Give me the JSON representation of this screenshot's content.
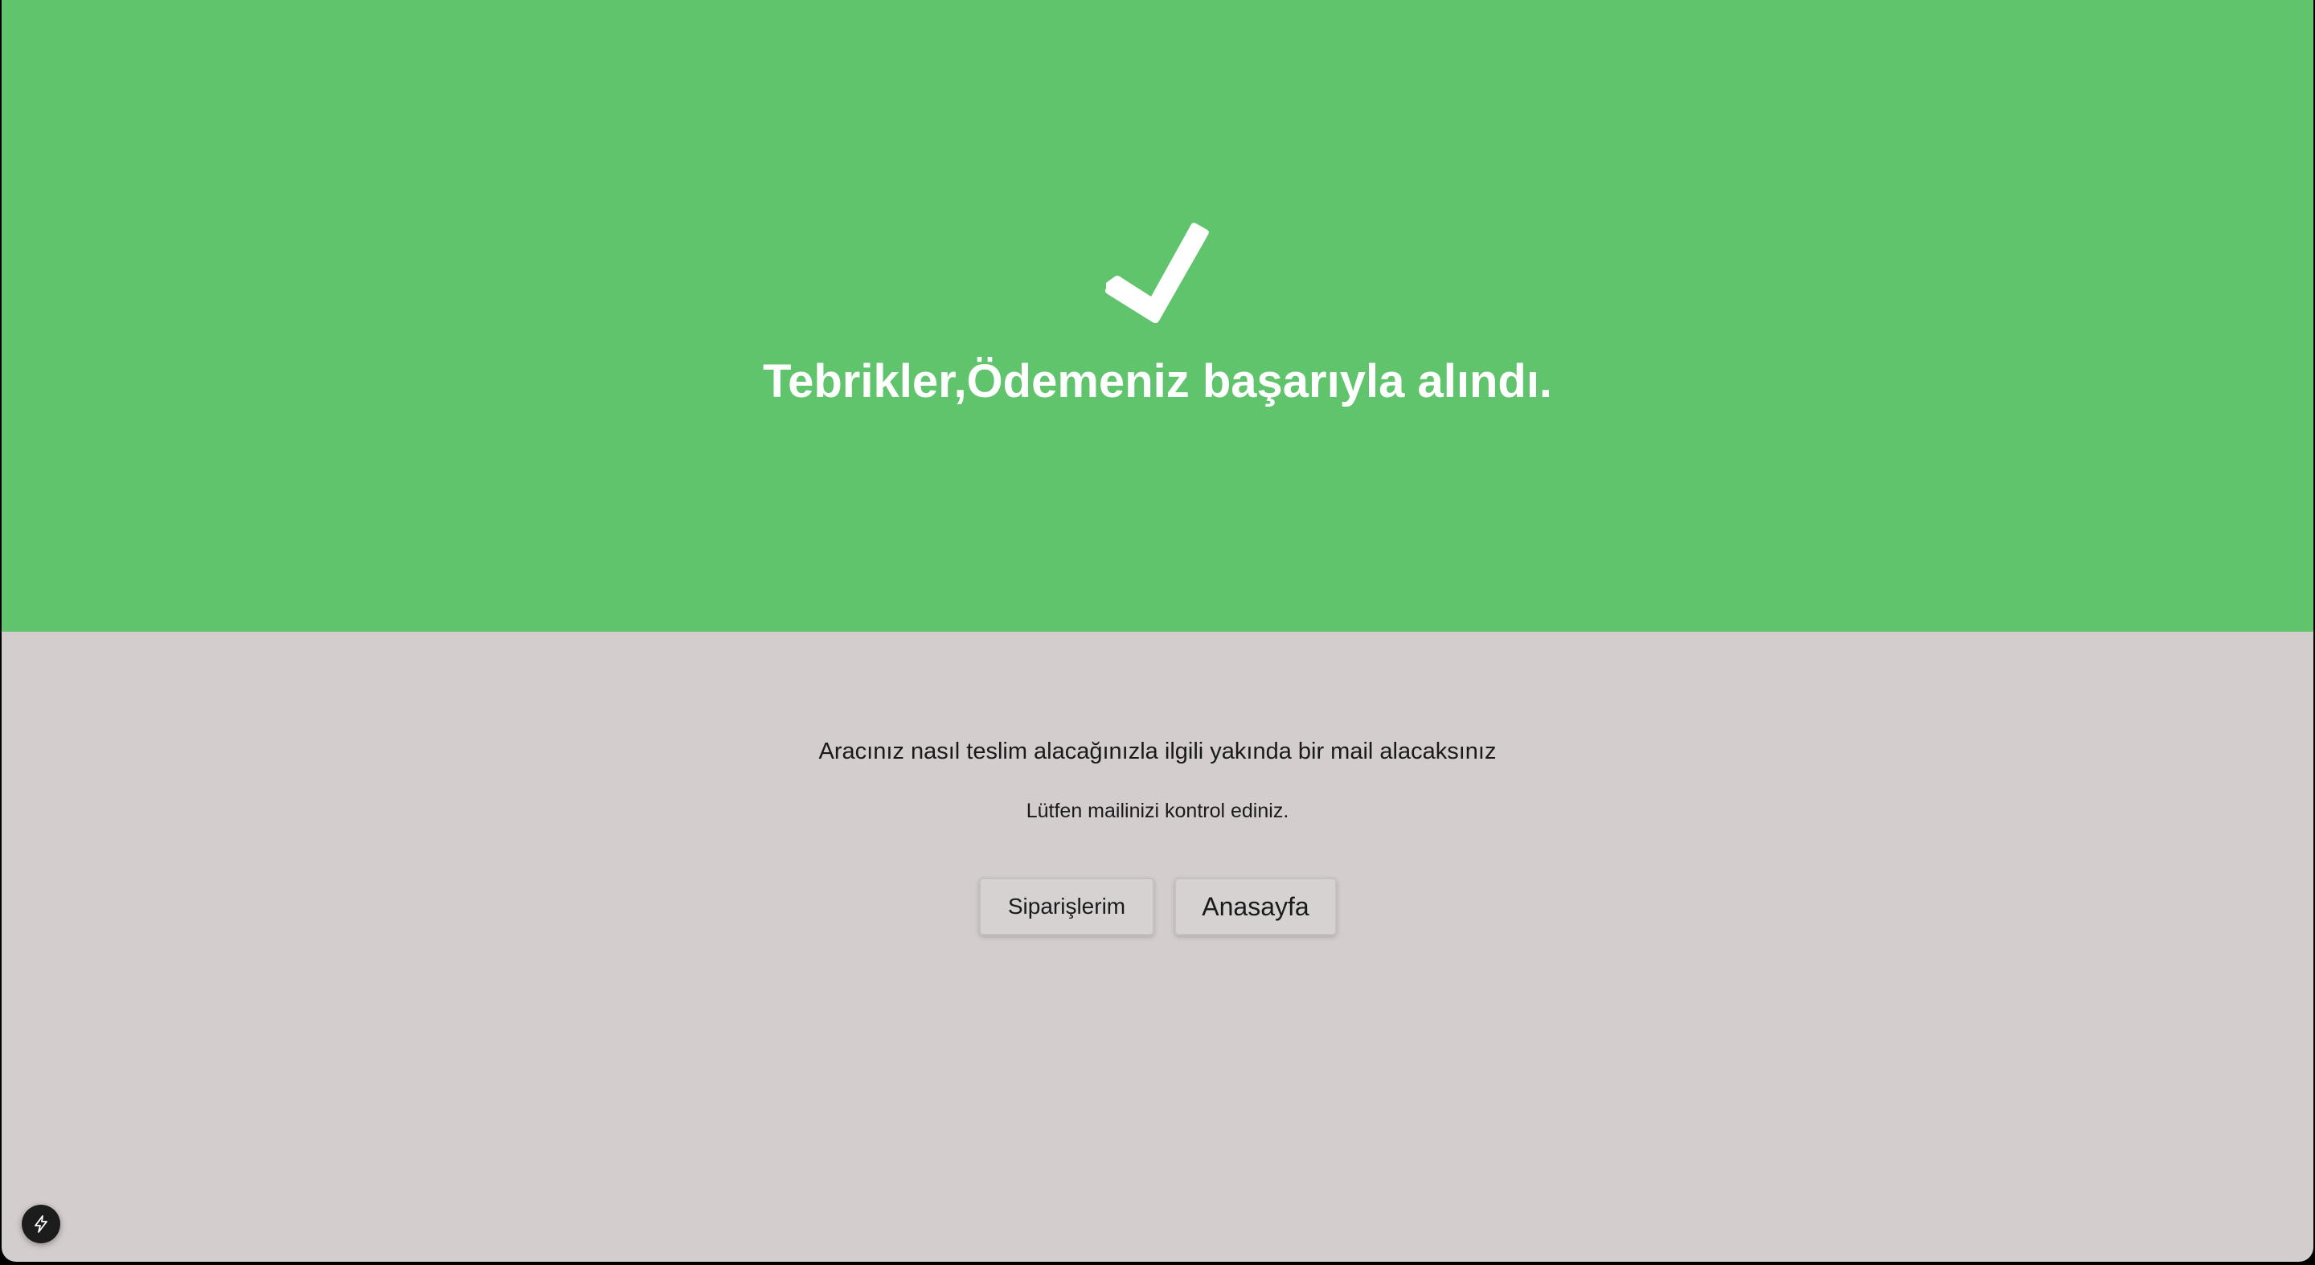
{
  "hero": {
    "icon": "check-icon",
    "title": "Tebrikler,Ödemeniz başarıyla alındı.",
    "background_color": "#5fc46b",
    "text_color": "#ffffff"
  },
  "content": {
    "message": "Aracınız nasıl teslim alacağınızla ilgili yakında bir mail alacaksınız",
    "sub_message": "Lütfen mailinizi kontrol ediniz.",
    "background_color": "#d3cdcd"
  },
  "actions": {
    "orders_label": "Siparişlerim",
    "home_label": "Anasayfa"
  },
  "floating_badge": {
    "icon": "lightning-bolt-icon"
  }
}
